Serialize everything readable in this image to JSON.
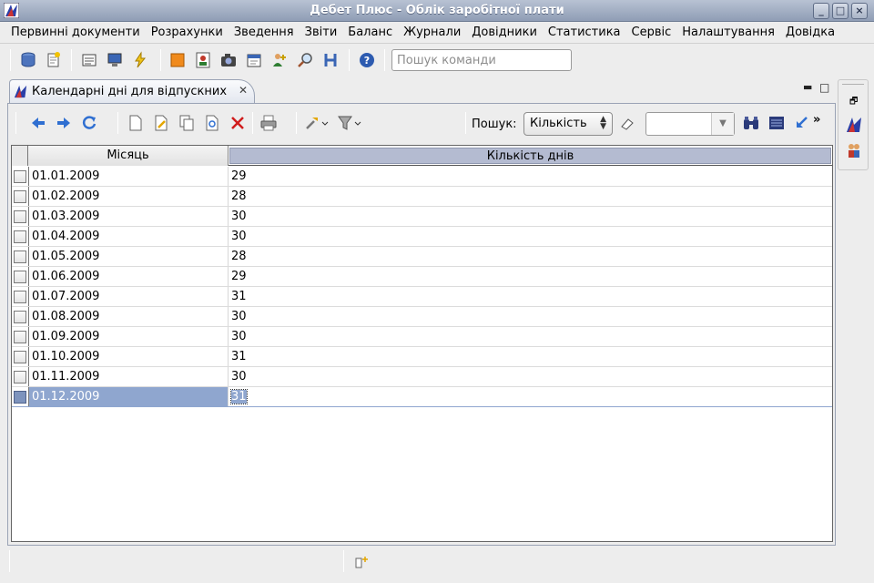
{
  "window": {
    "title": "Дебет Плюс - Облік заробітної плати"
  },
  "menu": [
    "Первинні документи",
    "Розрахунки",
    "Зведення",
    "Звіти",
    "Баланс",
    "Журнали",
    "Довідники",
    "Статистика",
    "Сервіс",
    "Налаштування",
    "Довідка"
  ],
  "toolbar": {
    "search_placeholder": "Пошук команди"
  },
  "tab": {
    "label": "Календарні дні для відпускних"
  },
  "search": {
    "label": "Пошук:",
    "field": "Кількість",
    "value": ""
  },
  "table": {
    "columns": [
      "Місяць",
      "Кількість днів"
    ],
    "rows": [
      {
        "month": "01.01.2009",
        "days": "29"
      },
      {
        "month": "01.02.2009",
        "days": "28"
      },
      {
        "month": "01.03.2009",
        "days": "30"
      },
      {
        "month": "01.04.2009",
        "days": "30"
      },
      {
        "month": "01.05.2009",
        "days": "28"
      },
      {
        "month": "01.06.2009",
        "days": "29"
      },
      {
        "month": "01.07.2009",
        "days": "31"
      },
      {
        "month": "01.08.2009",
        "days": "30"
      },
      {
        "month": "01.09.2009",
        "days": "30"
      },
      {
        "month": "01.10.2009",
        "days": "31"
      },
      {
        "month": "01.11.2009",
        "days": "30"
      },
      {
        "month": "01.12.2009",
        "days": "31"
      }
    ],
    "selected_index": 11
  },
  "colors": {
    "titlebar": "#9aa7be",
    "selection": "#8fa6cf",
    "header_active": "#b4bbd1"
  }
}
